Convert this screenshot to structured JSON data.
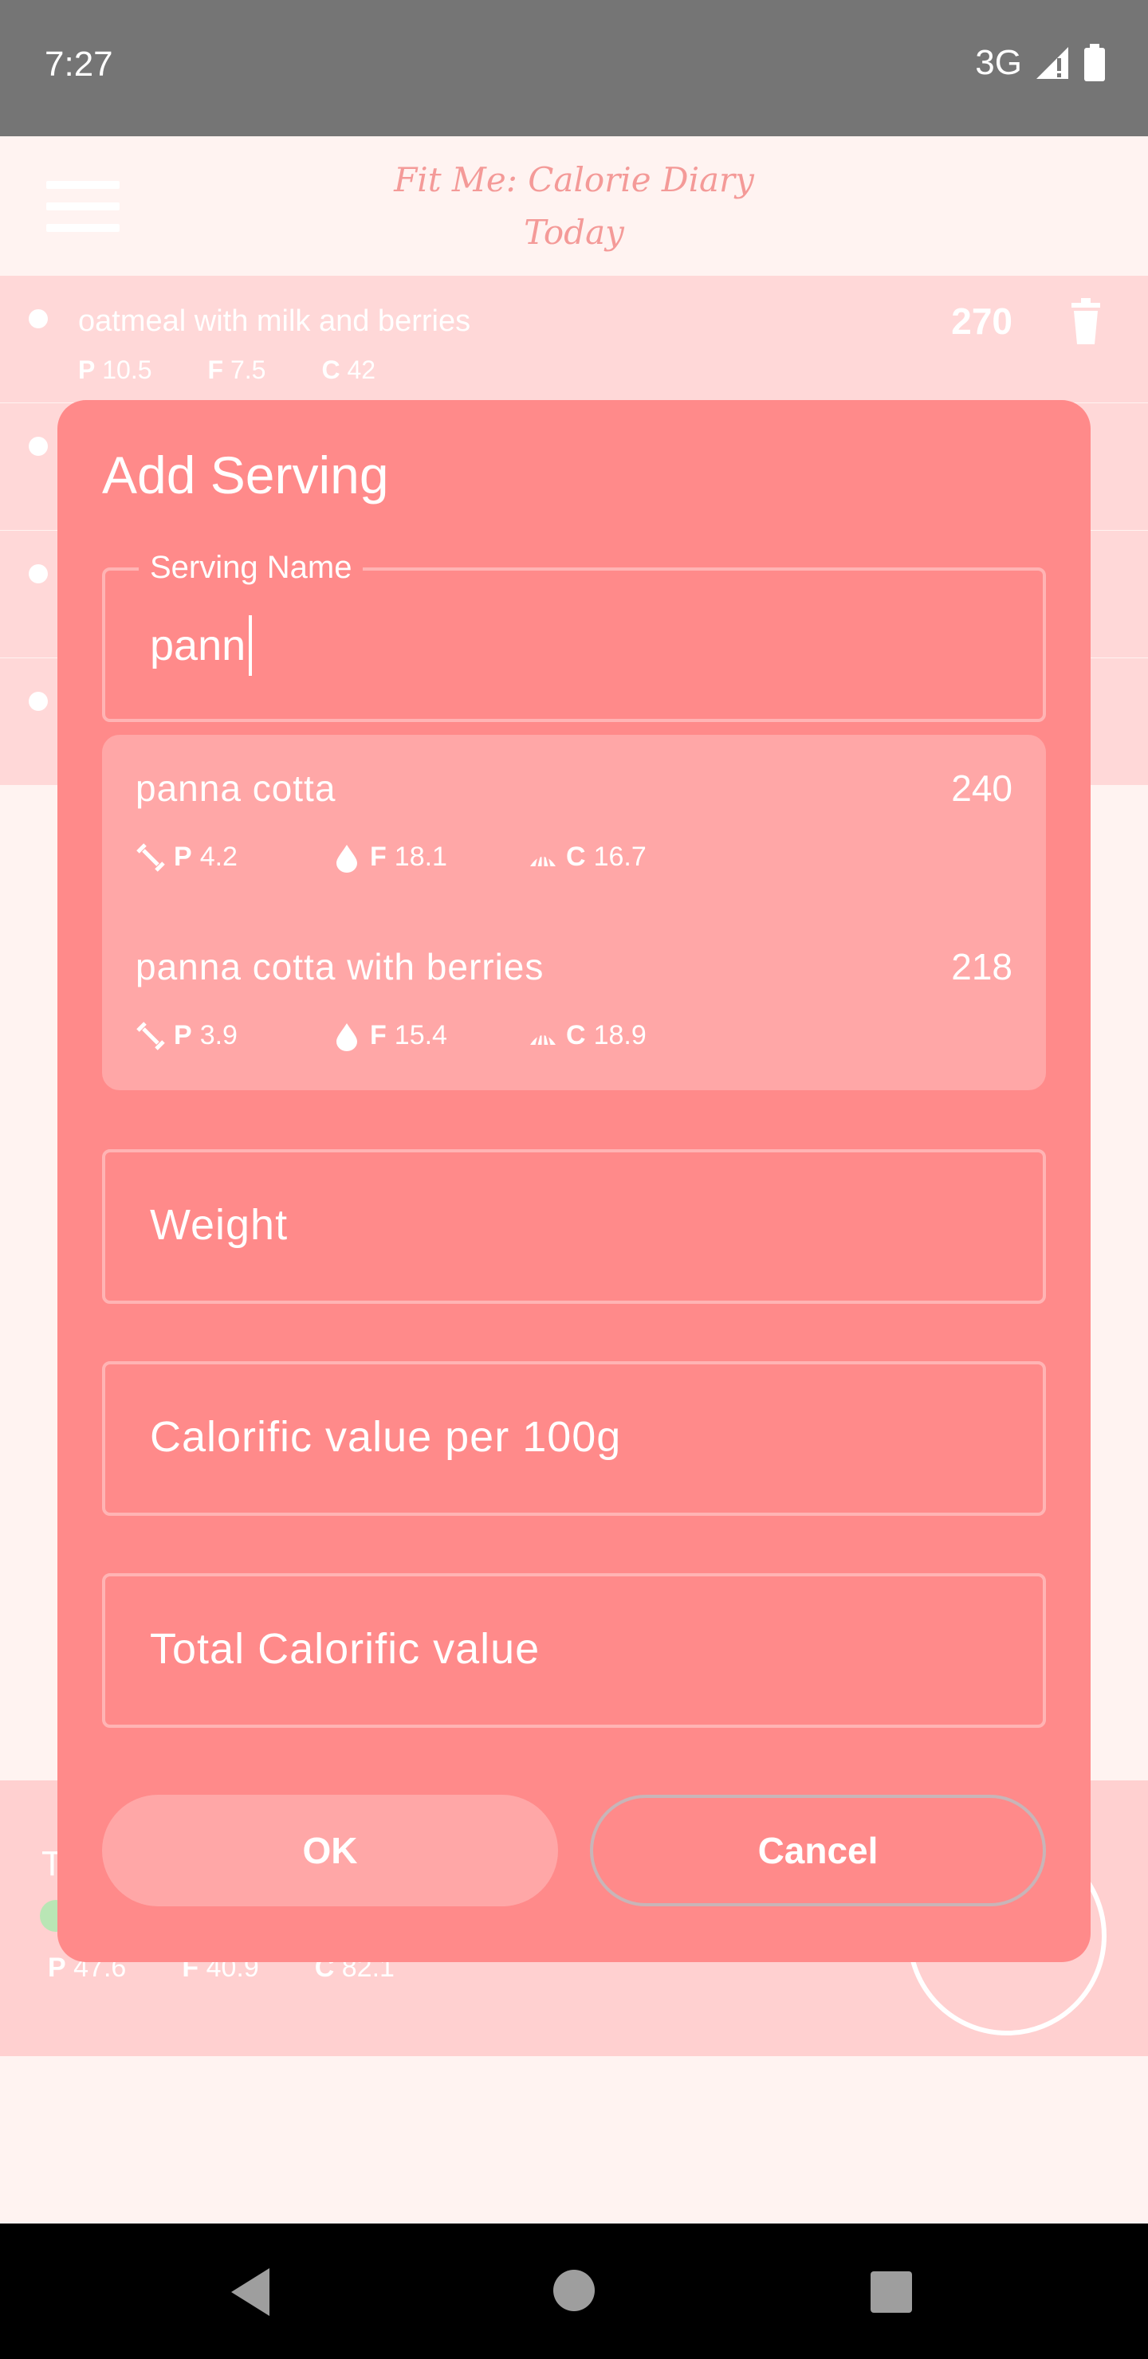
{
  "status_bar": {
    "time": "7:27",
    "network": "3G"
  },
  "app_bar": {
    "title": "Fit Me: Calorie Diary",
    "subtitle": "Today"
  },
  "background": {
    "first_entry": {
      "name": "oatmeal with milk and berries",
      "calories": "270",
      "protein": "10.5",
      "fat": "7.5",
      "carbs": "42"
    },
    "summary": {
      "label_initial": "T",
      "protein": "47.6",
      "fat": "40.9",
      "carbs": "82.1"
    }
  },
  "macro_labels": {
    "protein": "P",
    "fat": "F",
    "carbs": "C"
  },
  "dialog": {
    "title": "Add Serving",
    "serving_name": {
      "label": "Serving Name",
      "value": "pann"
    },
    "suggestions": [
      {
        "name": "panna cotta",
        "calories": "240",
        "protein": "4.2",
        "fat": "18.1",
        "carbs": "16.7"
      },
      {
        "name": "panna cotta with berries",
        "calories": "218",
        "protein": "3.9",
        "fat": "15.4",
        "carbs": "18.9"
      }
    ],
    "weight_placeholder": "Weight",
    "calorific_per_100g_placeholder": "Calorific value per 100g",
    "total_calorific_placeholder": "Total Calorific value",
    "ok_label": "OK",
    "cancel_label": "Cancel"
  },
  "colors": {
    "dialog": "#ff8a8a",
    "suggestion_panel": "#ffa7a7",
    "background": "#fff3f1",
    "row": "#ffd8d8"
  }
}
